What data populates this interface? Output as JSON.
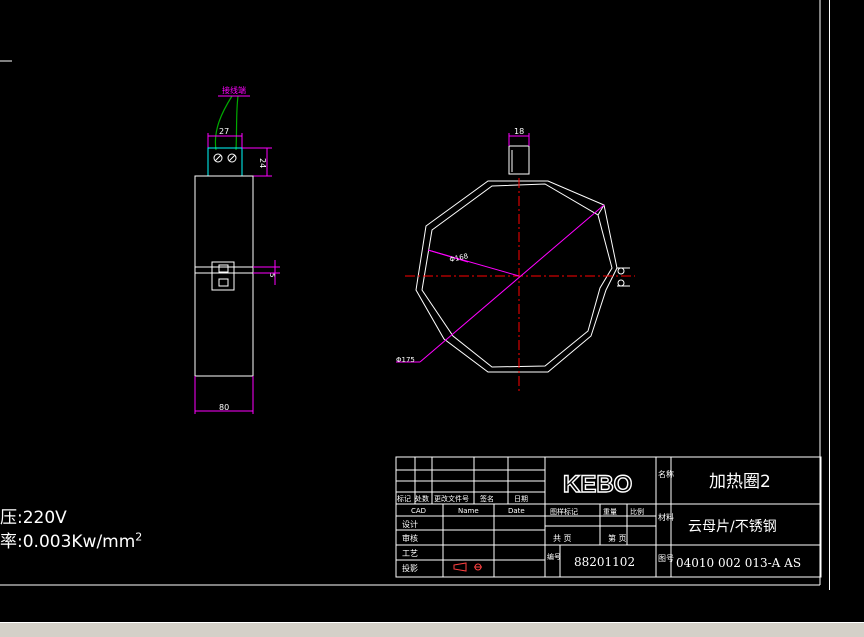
{
  "colors": {
    "background": "#000000",
    "line": "#ffffff",
    "dimension": "#ff00ff",
    "centerline": "#ff0000",
    "lead": "#00aa00",
    "terminal": "#00ffff"
  },
  "left_view": {
    "lead_label": "接线端",
    "dim_width_top": "27",
    "dim_height_small": "24",
    "dim_gap": "5",
    "dim_width_bottom": "80"
  },
  "right_view": {
    "dim_terminal": "18",
    "dim_inner": "Φ168",
    "dim_outer": "Φ175"
  },
  "specs": {
    "voltage": "压:220V",
    "density_prefix": "率:0.003Kw/mm",
    "density_sup": "2"
  },
  "title_block": {
    "logo": "KEBO",
    "rev_headers": [
      "标记",
      "处数",
      "更改文件号",
      "签名",
      "日期"
    ],
    "row_cad": [
      "CAD",
      "Name",
      "Date"
    ],
    "stage_headers": [
      "图样标记",
      "重量",
      "比例"
    ],
    "roles": [
      "设计",
      "审核",
      "工艺",
      "投影"
    ],
    "sheet_total": "共 页",
    "sheet_no": "第 页",
    "code_label": "编号",
    "code_value": "88201102",
    "name_label": "名称",
    "name_value": "加热圈2",
    "material_label": "材料",
    "material_value": "云母片/不锈钢",
    "drawing_no_label": "图号",
    "drawing_no_value": "04010 002 013-A AS"
  }
}
